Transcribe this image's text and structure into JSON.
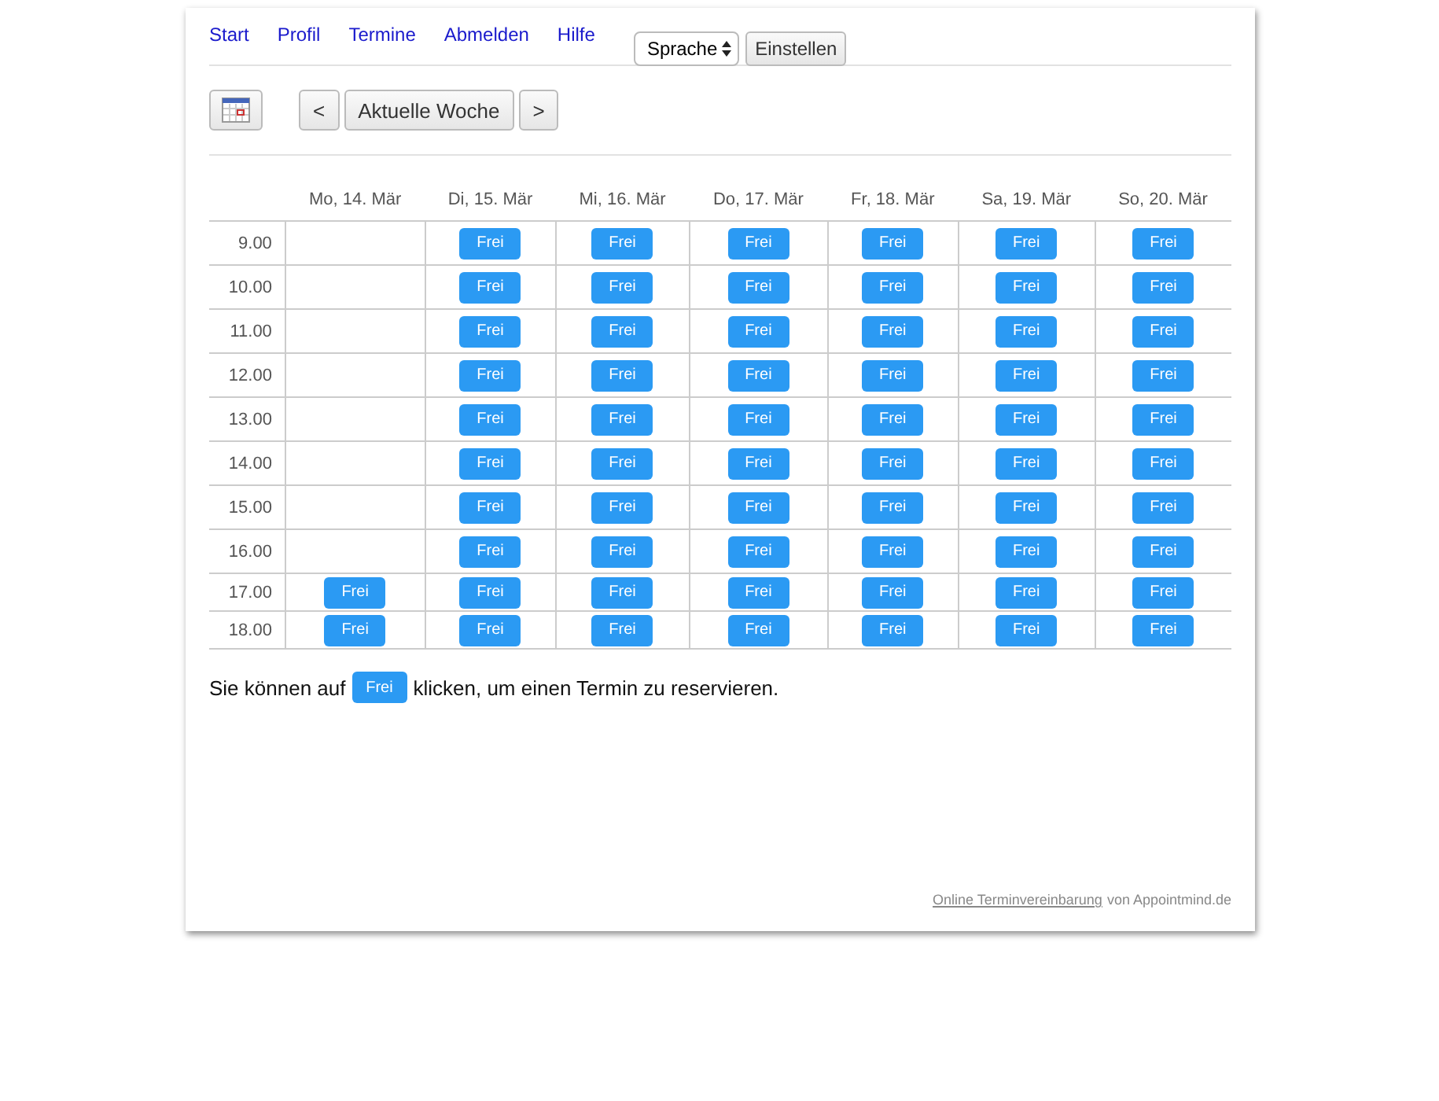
{
  "nav": {
    "links": [
      "Start",
      "Profil",
      "Termine",
      "Abmelden",
      "Hilfe"
    ],
    "language_select": "Sprache",
    "apply_button": "Einstellen"
  },
  "toolbar": {
    "prev": "<",
    "current": "Aktuelle Woche",
    "next": ">"
  },
  "table": {
    "columns": [
      "Mo, 14. Mär",
      "Di, 15. Mär",
      "Mi, 16. Mär",
      "Do, 17. Mär",
      "Fr, 18. Mär",
      "Sa, 19. Mär",
      "So, 20. Mär"
    ],
    "rows": [
      {
        "time": "9.00",
        "cells": [
          {
            "kind": "empty"
          },
          {
            "kind": "free",
            "label": "Frei"
          },
          {
            "kind": "free",
            "label": "Frei"
          },
          {
            "kind": "free",
            "label": "Frei"
          },
          {
            "kind": "free",
            "label": "Frei"
          },
          {
            "kind": "free",
            "label": "Frei"
          },
          {
            "kind": "free",
            "label": "Frei"
          }
        ]
      },
      {
        "time": "10.00",
        "cells": [
          {
            "kind": "empty"
          },
          {
            "kind": "free",
            "label": "Frei"
          },
          {
            "kind": "free",
            "label": "Frei"
          },
          {
            "kind": "free",
            "label": "Frei"
          },
          {
            "kind": "free",
            "label": "Frei"
          },
          {
            "kind": "free",
            "label": "Frei"
          },
          {
            "kind": "free",
            "label": "Frei"
          }
        ]
      },
      {
        "time": "11.00",
        "cells": [
          {
            "kind": "empty"
          },
          {
            "kind": "free",
            "label": "Frei"
          },
          {
            "kind": "free",
            "label": "Frei"
          },
          {
            "kind": "free",
            "label": "Frei"
          },
          {
            "kind": "free",
            "label": "Frei"
          },
          {
            "kind": "free",
            "label": "Frei"
          },
          {
            "kind": "free",
            "label": "Frei"
          }
        ]
      },
      {
        "time": "12.00",
        "cells": [
          {
            "kind": "empty"
          },
          {
            "kind": "free",
            "label": "Frei"
          },
          {
            "kind": "free",
            "label": "Frei"
          },
          {
            "kind": "free",
            "label": "Frei"
          },
          {
            "kind": "free",
            "label": "Frei"
          },
          {
            "kind": "free",
            "label": "Frei"
          },
          {
            "kind": "free",
            "label": "Frei"
          }
        ]
      },
      {
        "time": "13.00",
        "cells": [
          {
            "kind": "empty"
          },
          {
            "kind": "free",
            "label": "Frei"
          },
          {
            "kind": "free",
            "label": "Frei"
          },
          {
            "kind": "free",
            "label": "Frei"
          },
          {
            "kind": "free",
            "label": "Frei"
          },
          {
            "kind": "free",
            "label": "Frei"
          },
          {
            "kind": "free",
            "label": "Frei"
          }
        ]
      },
      {
        "time": "14.00",
        "cells": [
          {
            "kind": "empty"
          },
          {
            "kind": "free",
            "label": "Frei"
          },
          {
            "kind": "free",
            "label": "Frei"
          },
          {
            "kind": "free",
            "label": "Frei"
          },
          {
            "kind": "free",
            "label": "Frei"
          },
          {
            "kind": "free",
            "label": "Frei"
          },
          {
            "kind": "free",
            "label": "Frei"
          }
        ]
      },
      {
        "time": "15.00",
        "cells": [
          {
            "kind": "empty"
          },
          {
            "kind": "free",
            "label": "Frei"
          },
          {
            "kind": "free",
            "label": "Frei"
          },
          {
            "kind": "free",
            "label": "Frei"
          },
          {
            "kind": "free",
            "label": "Frei"
          },
          {
            "kind": "free",
            "label": "Frei"
          },
          {
            "kind": "free",
            "label": "Frei"
          }
        ]
      },
      {
        "time": "16.00",
        "cells": [
          {
            "kind": "empty"
          },
          {
            "kind": "free",
            "label": "Frei"
          },
          {
            "kind": "free",
            "label": "Frei"
          },
          {
            "kind": "free",
            "label": "Frei"
          },
          {
            "kind": "free",
            "label": "Frei"
          },
          {
            "kind": "free",
            "label": "Frei"
          },
          {
            "kind": "free",
            "label": "Frei"
          }
        ]
      },
      {
        "time": "17.00",
        "cells": [
          {
            "kind": "free",
            "label": "Frei"
          },
          {
            "kind": "free",
            "label": "Frei"
          },
          {
            "kind": "free",
            "label": "Frei"
          },
          {
            "kind": "free",
            "label": "Frei"
          },
          {
            "kind": "free",
            "label": "Frei"
          },
          {
            "kind": "free",
            "label": "Frei"
          },
          {
            "kind": "free",
            "label": "Frei"
          }
        ]
      },
      {
        "time": "18.00",
        "cells": [
          {
            "kind": "free",
            "label": "Frei"
          },
          {
            "kind": "free",
            "label": "Frei"
          },
          {
            "kind": "free",
            "label": "Frei"
          },
          {
            "kind": "free",
            "label": "Frei"
          },
          {
            "kind": "free",
            "label": "Frei"
          },
          {
            "kind": "free",
            "label": "Frei"
          },
          {
            "kind": "free",
            "label": "Frei"
          }
        ]
      }
    ]
  },
  "hint": {
    "before": "Sie können auf",
    "button": "Frei",
    "after": "klicken, um einen Termin zu reservieren."
  },
  "footer": {
    "link": "Online Terminvereinbarung",
    "text": "von Appointmind.de"
  }
}
